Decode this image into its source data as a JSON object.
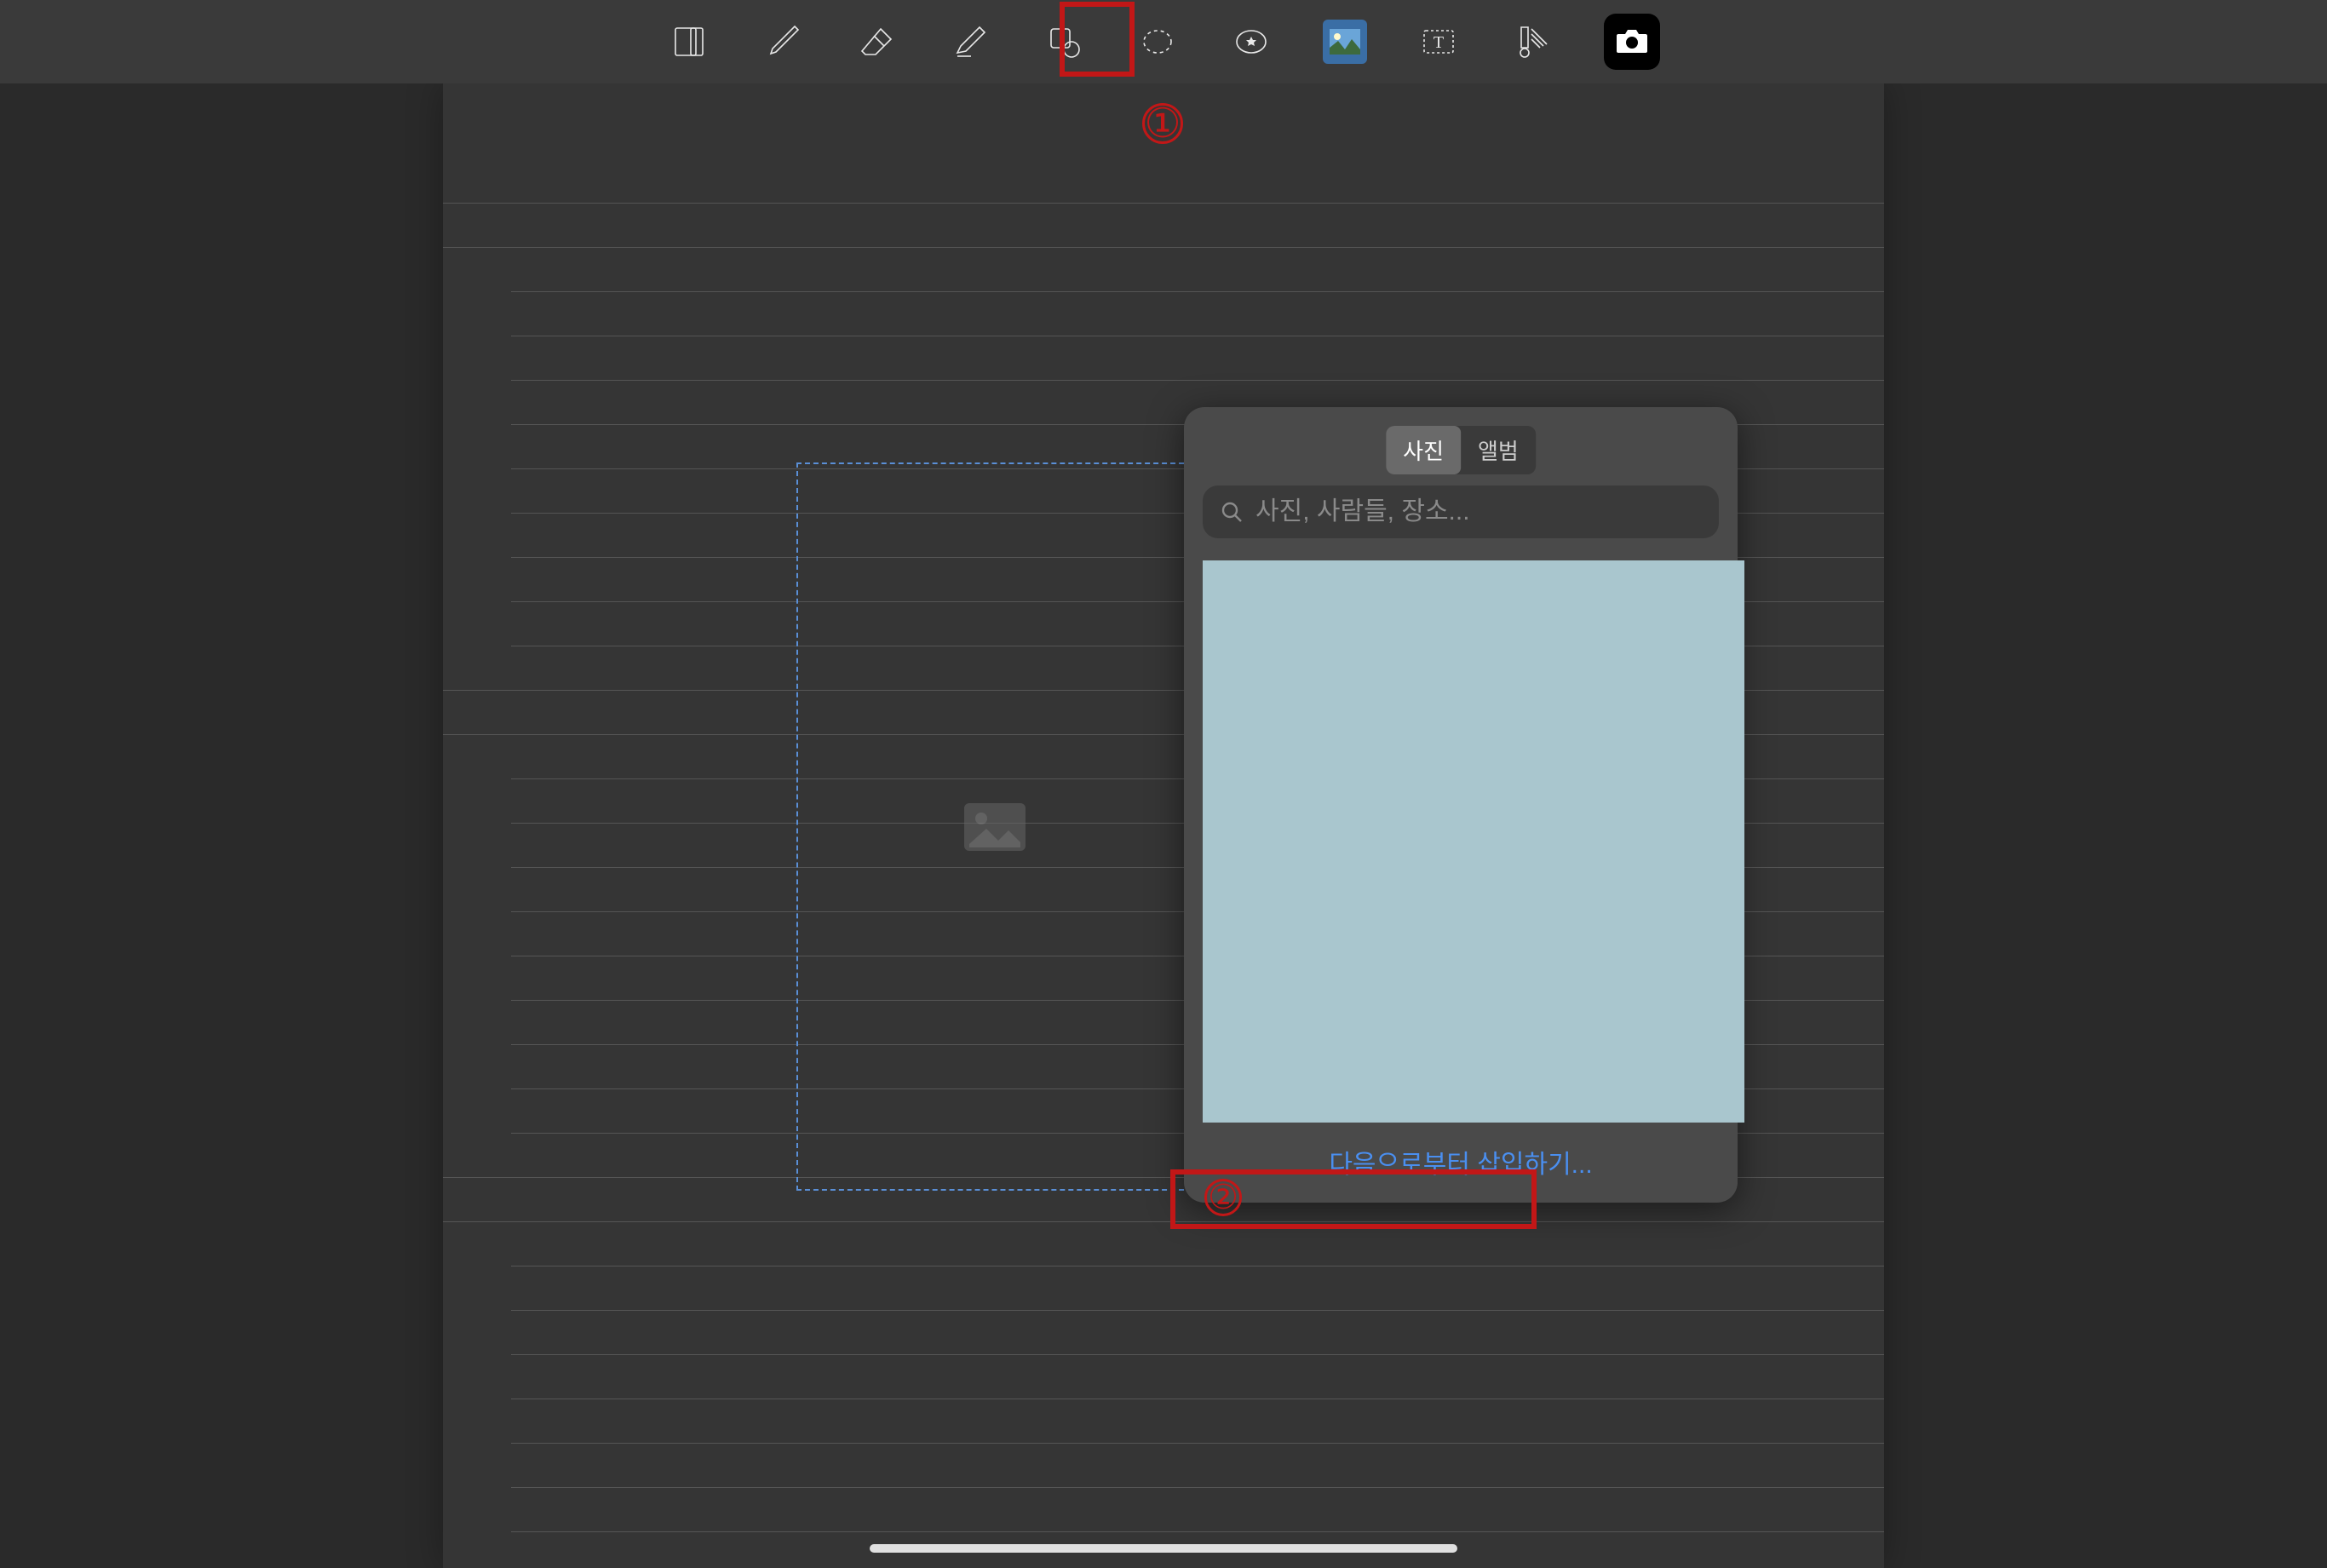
{
  "toolbar": {
    "tools": [
      "document-icon",
      "pen-icon",
      "eraser-icon",
      "highlighter-icon",
      "shape-icon",
      "lasso-icon",
      "favorites-icon",
      "image-icon",
      "text-icon",
      "ruler-icon",
      "camera-icon"
    ]
  },
  "annotations": {
    "step1": "①",
    "step2": "②"
  },
  "popover": {
    "tabs": {
      "photos": "사진",
      "albums": "앨범"
    },
    "search_placeholder": "사진, 사람들, 장소...",
    "insert_from": "다음으로부터 삽입하기...",
    "thumbnail_color": "#a9c6ce"
  }
}
